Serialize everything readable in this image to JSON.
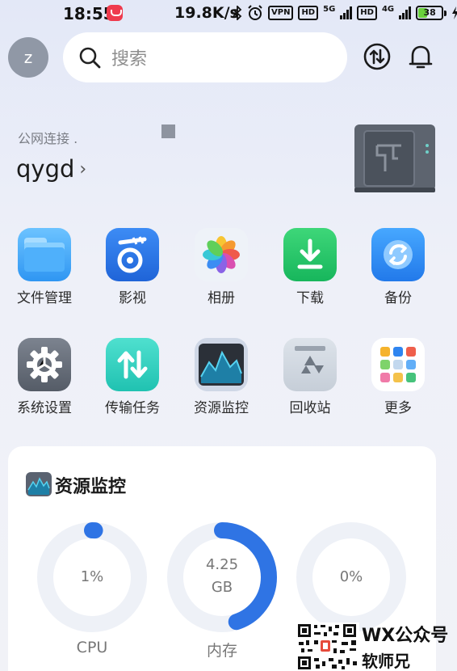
{
  "status_bar": {
    "time": "18:55",
    "net_speed": "19.8K/s",
    "vpn": "VPN",
    "hd1": "HD",
    "net1": "5G",
    "hd2": "HD",
    "net2": "4G",
    "battery": "38"
  },
  "header": {
    "avatar_letter": "z",
    "search_placeholder": "搜索"
  },
  "device": {
    "connection_label": "公网连接 .",
    "name": "qygd",
    "chevron": "›"
  },
  "apps": [
    {
      "label": "文件管理",
      "icon": "folder-icon"
    },
    {
      "label": "影视",
      "icon": "video-icon"
    },
    {
      "label": "相册",
      "icon": "photos-icon"
    },
    {
      "label": "下载",
      "icon": "download-icon"
    },
    {
      "label": "备份",
      "icon": "backup-icon"
    },
    {
      "label": "系统设置",
      "icon": "settings-icon"
    },
    {
      "label": "传输任务",
      "icon": "transfer-icon"
    },
    {
      "label": "资源监控",
      "icon": "monitor-icon"
    },
    {
      "label": "回收站",
      "icon": "recycle-icon"
    },
    {
      "label": "更多",
      "icon": "more-icon"
    }
  ],
  "monitor": {
    "title": "资源监控",
    "gauges": [
      {
        "label": "CPU",
        "value_line1": "1%",
        "value_line2": "",
        "fraction": 0.01
      },
      {
        "label": "内存",
        "value_line1": "4.25",
        "value_line2": "GB",
        "fraction": 0.45
      },
      {
        "label": "",
        "value_line1": "0%",
        "value_line2": "",
        "fraction": 0
      }
    ]
  },
  "watermark": {
    "title": "WX公众号",
    "subtitle": "软师兄"
  },
  "colors": {
    "accent": "#2f74e4",
    "gauge_track": "#eef1f7"
  }
}
